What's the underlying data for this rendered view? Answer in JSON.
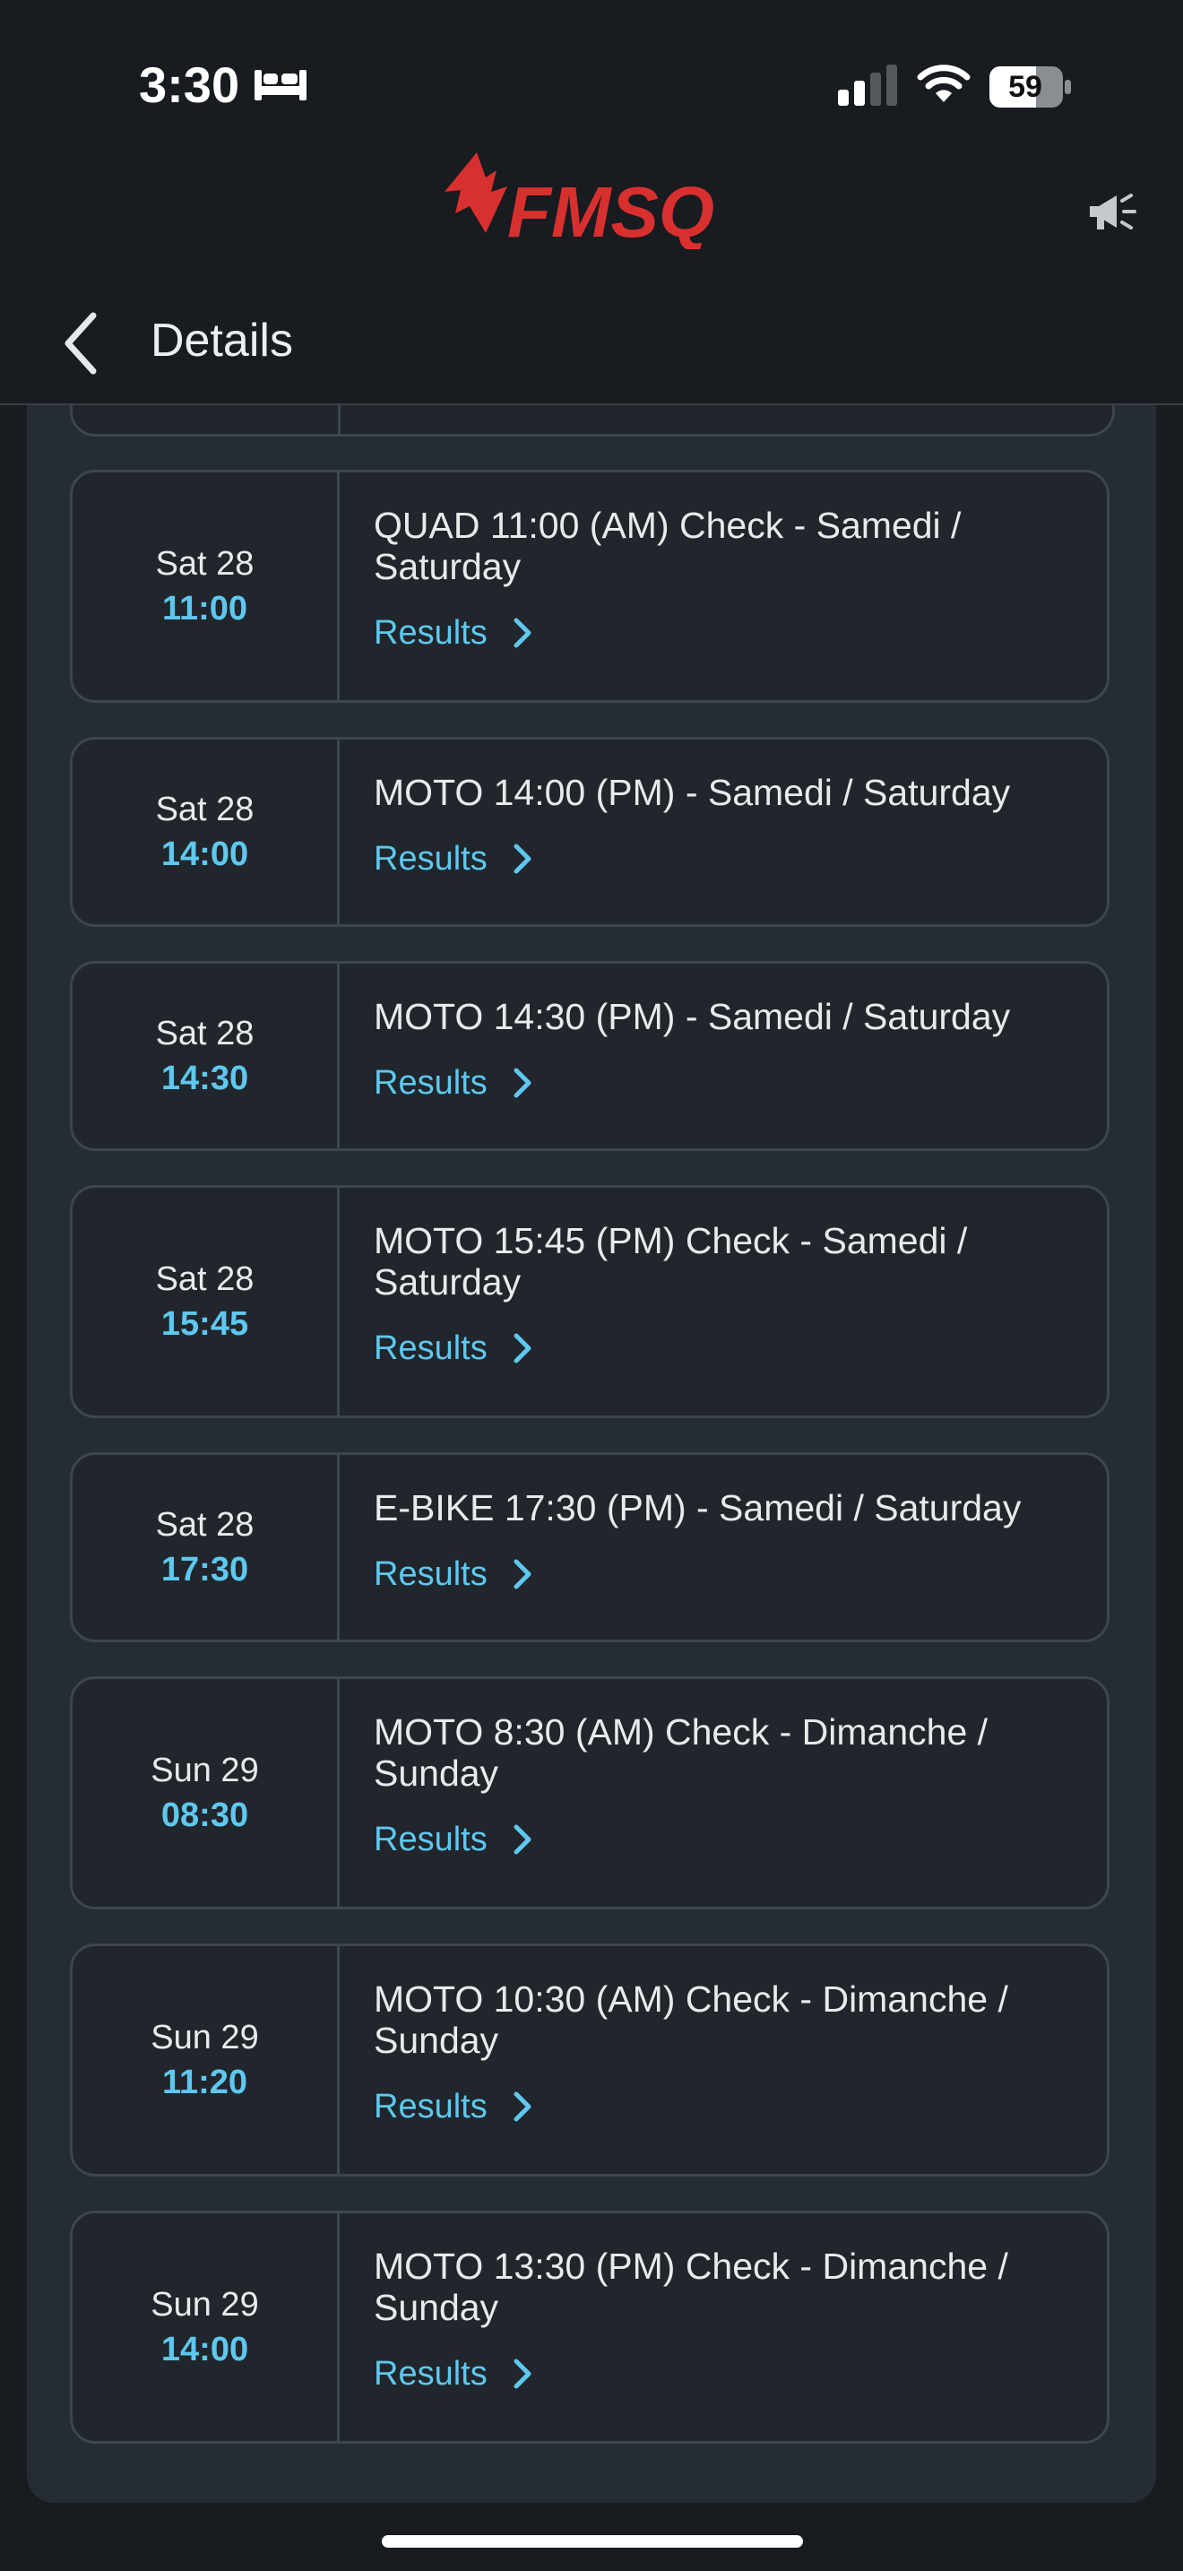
{
  "status_bar": {
    "time": "3:30",
    "battery": "59"
  },
  "header": {
    "brand": "FMSQ"
  },
  "nav": {
    "title": "Details"
  },
  "events": [
    {
      "day": "Sat 28",
      "time": "11:00",
      "title": "QUAD 11:00 (AM) Check - Samedi / Saturday",
      "link": "Results"
    },
    {
      "day": "Sat 28",
      "time": "14:00",
      "title": "MOTO 14:00 (PM) - Samedi / Saturday",
      "link": "Results"
    },
    {
      "day": "Sat 28",
      "time": "14:30",
      "title": "MOTO 14:30 (PM) - Samedi / Saturday",
      "link": "Results"
    },
    {
      "day": "Sat 28",
      "time": "15:45",
      "title": "MOTO 15:45 (PM) Check - Samedi / Saturday",
      "link": "Results"
    },
    {
      "day": "Sat 28",
      "time": "17:30",
      "title": "E-BIKE 17:30 (PM) - Samedi / Saturday",
      "link": "Results"
    },
    {
      "day": "Sun 29",
      "time": "08:30",
      "title": "MOTO 8:30 (AM) Check - Dimanche / Sunday",
      "link": "Results"
    },
    {
      "day": "Sun 29",
      "time": "11:20",
      "title": "MOTO 10:30 (AM) Check - Dimanche / Sunday",
      "link": "Results"
    },
    {
      "day": "Sun 29",
      "time": "14:00",
      "title": "MOTO 13:30 (PM) Check - Dimanche / Sunday",
      "link": "Results"
    }
  ]
}
